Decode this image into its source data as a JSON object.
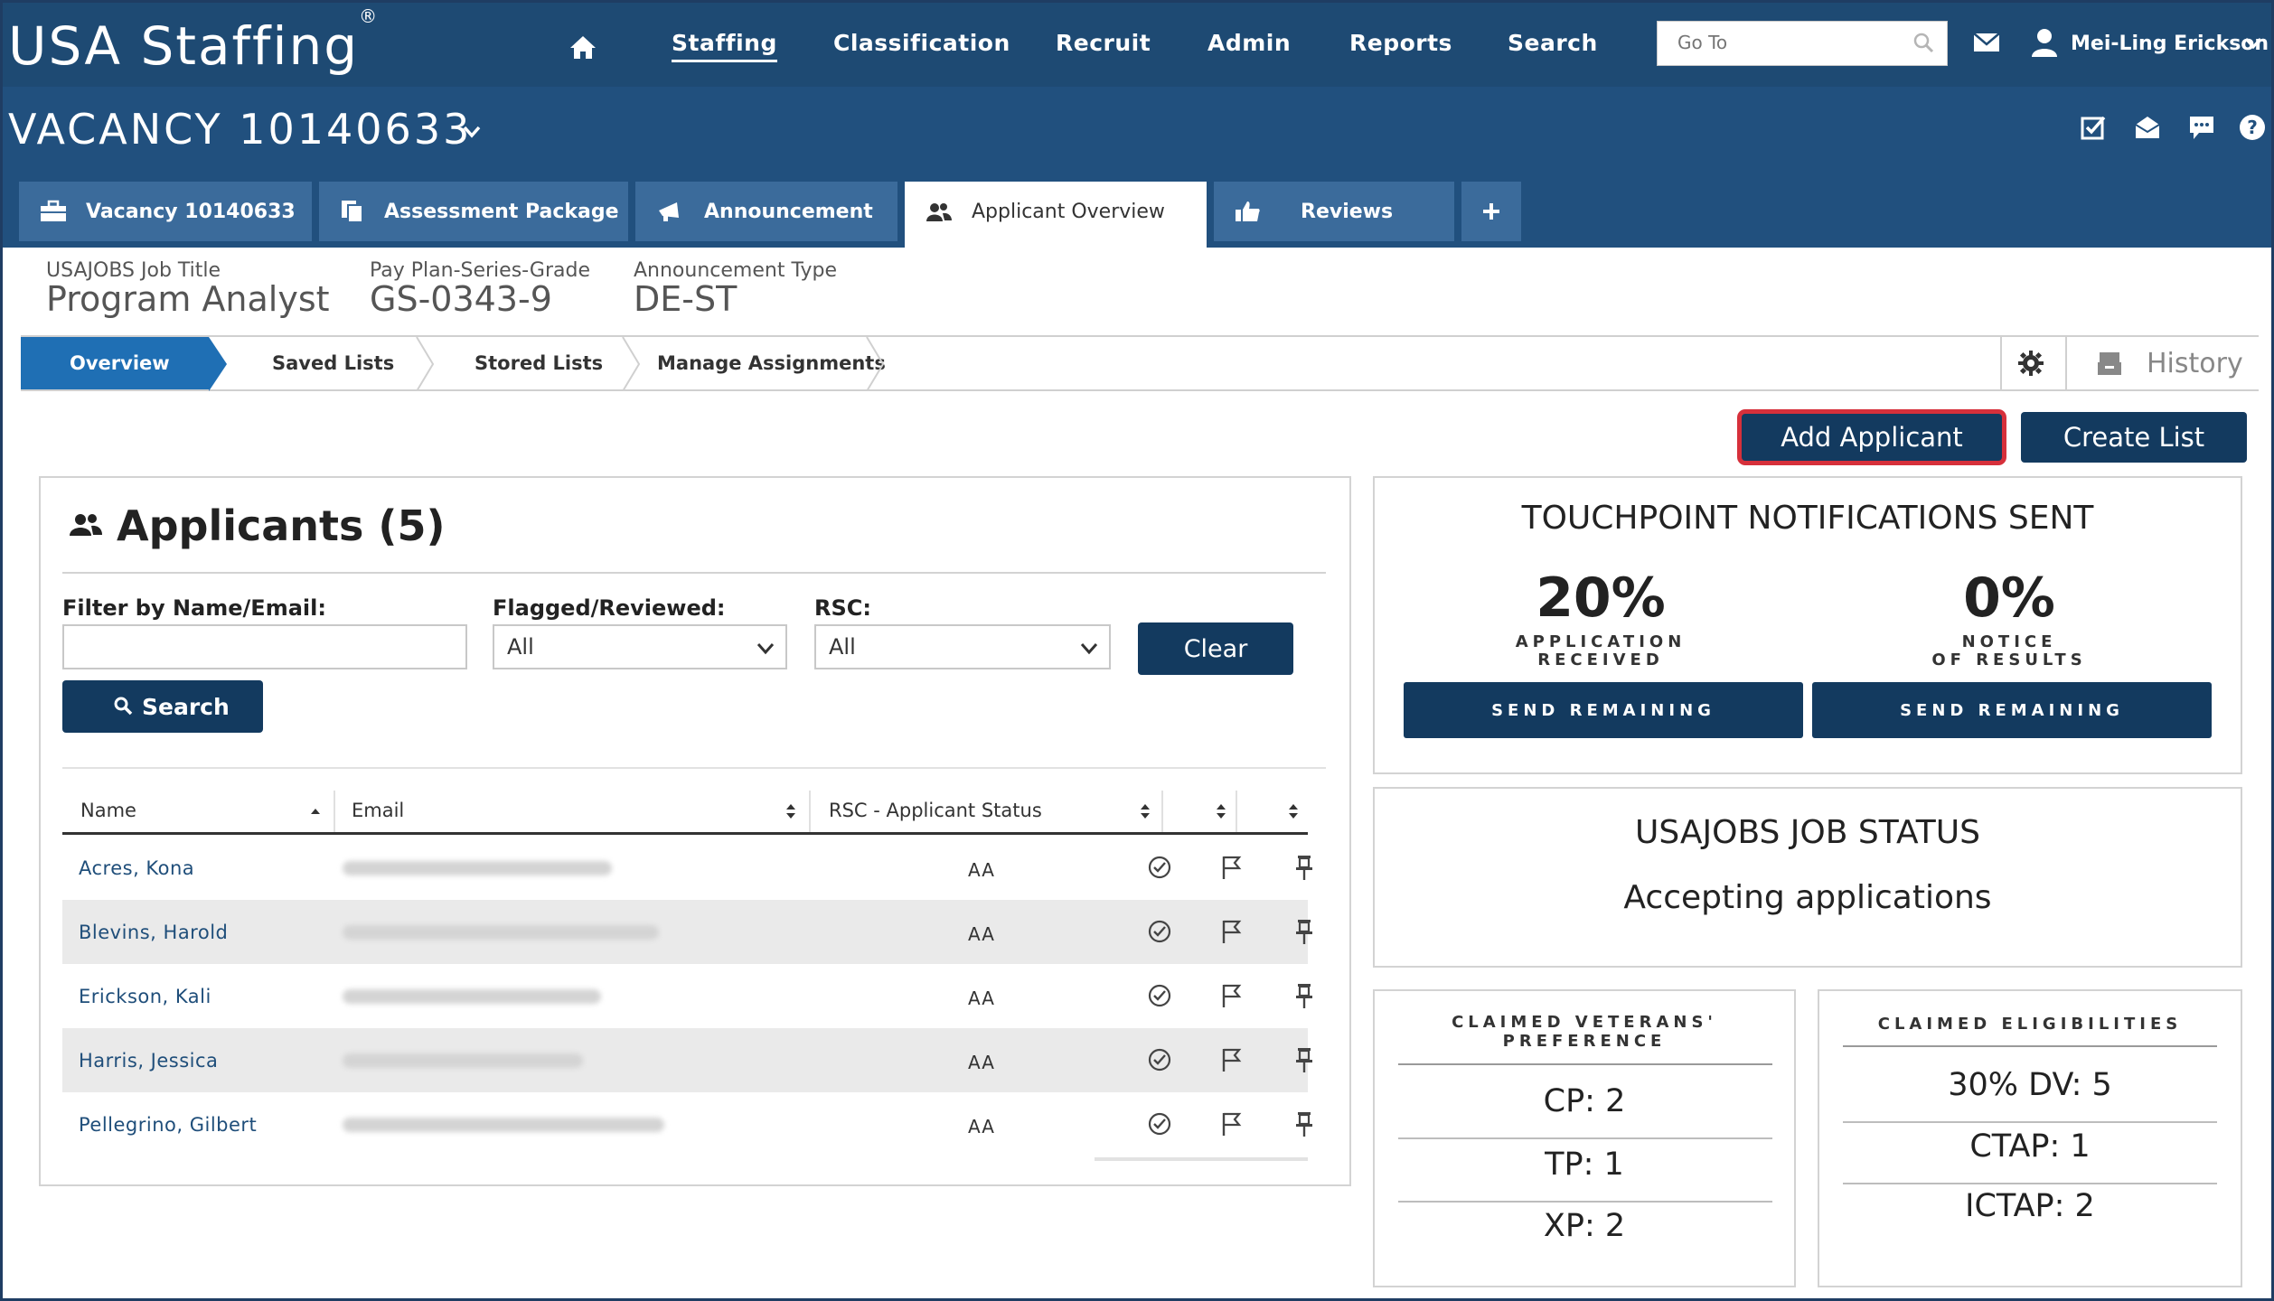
{
  "app": {
    "logo": "USA Staffing",
    "logo_mark": "®"
  },
  "topnav": {
    "items": [
      "Staffing",
      "Classification",
      "Recruit",
      "Admin",
      "Reports",
      "Search"
    ],
    "goto_placeholder": "Go To",
    "user_name": "Mei-Ling Erickson"
  },
  "vacancy": {
    "title": "VACANCY 10140633"
  },
  "tabs": [
    {
      "label": "Vacancy 10140633",
      "icon": "briefcase-icon"
    },
    {
      "label": "Assessment Package",
      "icon": "copy-icon"
    },
    {
      "label": "Announcement",
      "icon": "megaphone-icon"
    },
    {
      "label": "Applicant Overview",
      "icon": "users-icon",
      "active": true
    },
    {
      "label": "Reviews",
      "icon": "thumbs-up-icon"
    }
  ],
  "job": {
    "title_label": "USAJOBS Job Title",
    "title_value": "Program Analyst",
    "grade_label": "Pay Plan-Series-Grade",
    "grade_value": "GS-0343-9",
    "type_label": "Announcement Type",
    "type_value": "DE-ST"
  },
  "subnav": {
    "items": [
      "Overview",
      "Saved Lists",
      "Stored Lists",
      "Manage Assignments"
    ],
    "active": "Overview",
    "history_label": "History"
  },
  "actions": {
    "add_applicant": "Add Applicant",
    "create_list": "Create List"
  },
  "applicants": {
    "title": "Applicants (5)",
    "filter_label": "Filter by Name/Email:",
    "filter_value": "",
    "flagged_label": "Flagged/Reviewed:",
    "flagged_value": "All",
    "rsc_label": "RSC:",
    "rsc_value": "All",
    "clear_label": "Clear",
    "search_label": "Search",
    "columns": [
      "Name",
      "Email",
      "RSC - Applicant Status"
    ],
    "rows": [
      {
        "name": "Acres, Kona",
        "rsc": "AA"
      },
      {
        "name": "Blevins, Harold",
        "rsc": "AA"
      },
      {
        "name": "Erickson, Kali",
        "rsc": "AA"
      },
      {
        "name": "Harris, Jessica",
        "rsc": "AA"
      },
      {
        "name": "Pellegrino, Gilbert",
        "rsc": "AA"
      }
    ]
  },
  "touchpoint": {
    "title": "TOUCHPOINT NOTIFICATIONS SENT",
    "received_pct": "20%",
    "received_label_1": "APPLICATION",
    "received_label_2": "RECEIVED",
    "notice_pct": "0%",
    "notice_label_1": "NOTICE",
    "notice_label_2": "OF RESULTS",
    "send_label": "SEND REMAINING"
  },
  "job_status": {
    "title": "USAJOBS JOB STATUS",
    "status": "Accepting applications"
  },
  "veterans": {
    "title_1": "CLAIMED VETERANS'",
    "title_2": "PREFERENCE",
    "items": [
      "CP: 2",
      "TP: 1",
      "XP: 2"
    ]
  },
  "eligibilities": {
    "title": "CLAIMED ELIGIBILITIES",
    "items": [
      "30% DV: 5",
      "CTAP: 1",
      "ICTAP: 2"
    ]
  },
  "colors": {
    "header": "#1e4a73",
    "band": "#21507e",
    "tab": "#3b6b9b",
    "button": "#133a5f",
    "overview": "#1f6fb4",
    "highlight": "#d6303b"
  }
}
